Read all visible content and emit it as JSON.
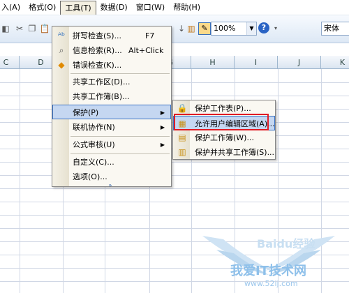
{
  "menubar": {
    "items": [
      "入(A)",
      "格式(O)",
      "工具(T)",
      "数据(D)",
      "窗口(W)",
      "帮助(H)"
    ],
    "active_index": 2
  },
  "toolbar": {
    "zoom": "100%",
    "font": "宋体"
  },
  "columns": [
    "C",
    "D",
    "E",
    "F",
    "G",
    "H",
    "I",
    "J",
    "K"
  ],
  "tools_menu": {
    "items": [
      {
        "label": "拼写检查(S)...",
        "shortcut": "F7",
        "icon": "spell-check-icon"
      },
      {
        "label": "信息检索(R)...",
        "shortcut": "Alt+Click",
        "icon": "research-icon"
      },
      {
        "label": "错误检查(K)...",
        "shortcut": "",
        "icon": "error-check-icon"
      },
      {
        "label": "共享工作区(D)...",
        "shortcut": "",
        "icon": ""
      },
      {
        "label": "共享工作簿(B)...",
        "shortcut": "",
        "icon": ""
      },
      {
        "label": "保护(P)",
        "shortcut": "",
        "icon": "",
        "submenu": true
      },
      {
        "label": "联机协作(N)",
        "shortcut": "",
        "icon": "",
        "submenu": true
      },
      {
        "label": "公式审核(U)",
        "shortcut": "",
        "icon": "",
        "submenu": true
      },
      {
        "label": "自定义(C)...",
        "shortcut": "",
        "icon": ""
      },
      {
        "label": "选项(O)...",
        "shortcut": "",
        "icon": ""
      }
    ]
  },
  "protect_submenu": {
    "items": [
      {
        "label": "保护工作表(P)...",
        "icon": "protect-sheet-icon"
      },
      {
        "label": "允许用户编辑区域(A)...",
        "icon": "allow-edit-ranges-icon"
      },
      {
        "label": "保护工作簿(W)...",
        "icon": "protect-workbook-icon"
      },
      {
        "label": "保护并共享工作簿(S)...",
        "icon": "protect-share-icon"
      }
    ]
  },
  "watermark": {
    "brand": "Baidu经验",
    "site": "我爱IT技术网",
    "url": "www.52ij.com"
  }
}
